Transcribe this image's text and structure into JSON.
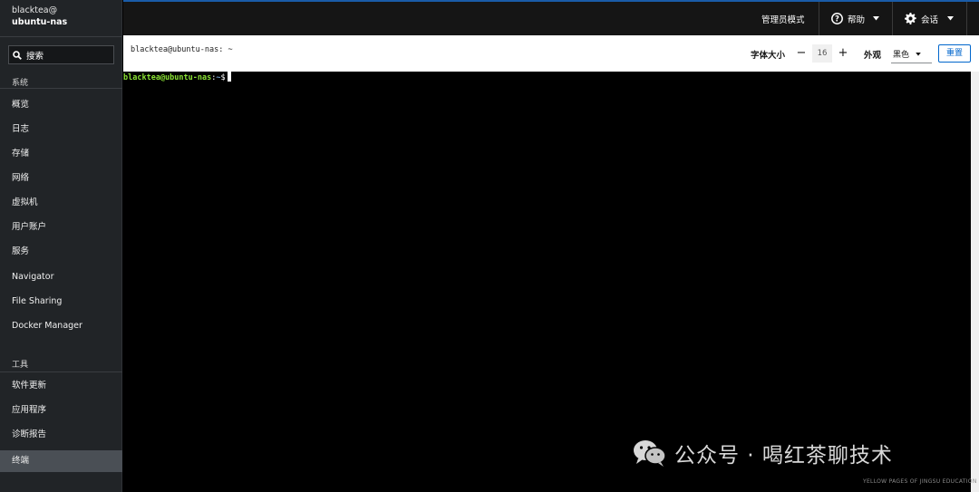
{
  "colors": {
    "accent": "#0066cc",
    "sidebar_bg": "#212427",
    "topbar_border": "#1a5ca8",
    "prompt_green": "#8ae234",
    "prompt_blue": "#729fcf"
  },
  "host": {
    "user": "blacktea@",
    "name": "ubuntu-nas"
  },
  "search": {
    "label": "搜索",
    "icon": "search-icon"
  },
  "sidebar": {
    "system_title": "系统",
    "system_items": [
      {
        "label": "概览"
      },
      {
        "label": "日志"
      },
      {
        "label": "存储"
      },
      {
        "label": "网络"
      },
      {
        "label": "虚拟机"
      },
      {
        "label": "用户账户"
      },
      {
        "label": "服务"
      },
      {
        "label": "Navigator"
      },
      {
        "label": "File Sharing"
      },
      {
        "label": "Docker Manager"
      }
    ],
    "tools_title": "工具",
    "tool_items": [
      {
        "label": "软件更新"
      },
      {
        "label": "应用程序"
      },
      {
        "label": "诊断报告"
      },
      {
        "label": "终端",
        "active": true
      }
    ]
  },
  "topbar": {
    "admin_mode": "管理员模式",
    "help": "帮助",
    "session": "会话"
  },
  "toolbar": {
    "title": "blacktea@ubuntu-nas: ~",
    "font_size_label": "字体大小",
    "decrement": "−",
    "font_size_value": "16",
    "increment": "+",
    "appearance_label": "外观",
    "appearance_value": "黑色",
    "reset": "重置"
  },
  "terminal": {
    "prompt_user": "blacktea@ubuntu-nas",
    "prompt_sep": ":",
    "prompt_path": "~",
    "prompt_symbol": "$"
  },
  "watermark": {
    "brand": "公众号 · 喝红茶聊技术",
    "small": "YELLOW PAGES OF JINGSU EDUCATION"
  }
}
